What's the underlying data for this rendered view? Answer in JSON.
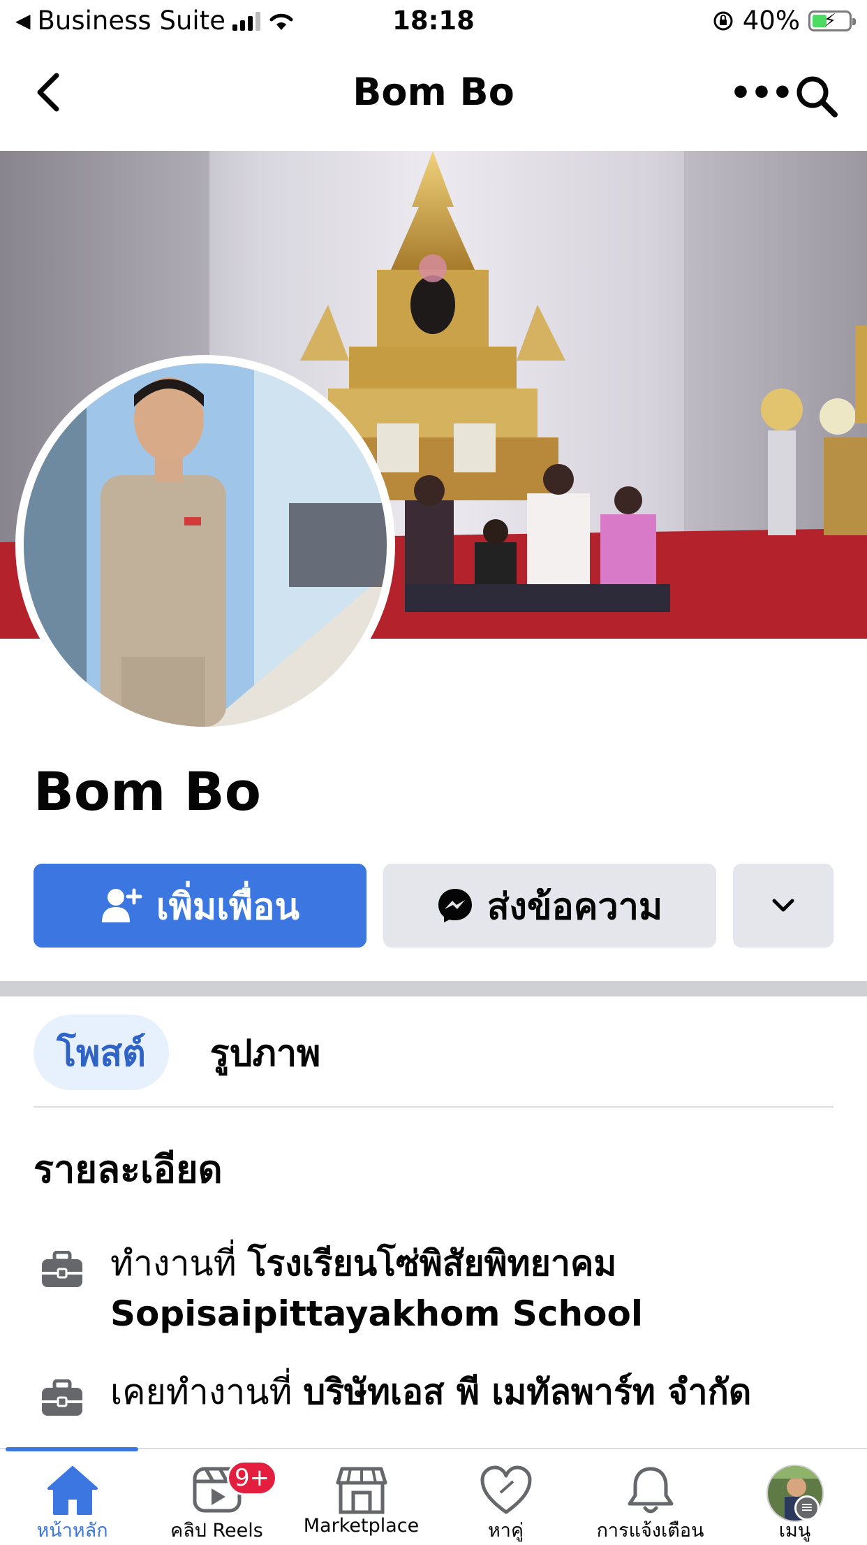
{
  "status_bar": {
    "carrier": "Business Suite",
    "time": "18:18",
    "battery": "40%",
    "battery_level": 0.4
  },
  "header": {
    "title": "Bom Bo",
    "icons": [
      "back-arrow-icon",
      "more-icon",
      "search-icon"
    ]
  },
  "profile": {
    "name": "Bom Bo"
  },
  "actions": {
    "add_friend": "เพิ่มเพื่อน",
    "message": "ส่งข้อความ"
  },
  "tabs": [
    {
      "label": "โพสต์",
      "active": true
    },
    {
      "label": "รูปภาพ",
      "active": false
    }
  ],
  "details": {
    "title": "รายละเอียด",
    "items": [
      {
        "prefix": "ทำงานที่",
        "value": "โรงเรียนโซ่พิสัยพิทยาคม Sopisaipittayakhom School",
        "icon": "briefcase-icon"
      },
      {
        "prefix": "เคยทำงานที่",
        "value": "บริษัทเอส พี เมทัลพาร์ท จำกัด",
        "icon": "briefcase-icon"
      }
    ]
  },
  "bottom_tabs": [
    {
      "label": "หน้าหลัก",
      "icon": "home-icon",
      "active": true
    },
    {
      "label": "คลิป Reels",
      "icon": "reels-icon",
      "badge": "9+"
    },
    {
      "label": "Marketplace",
      "icon": "marketplace-icon"
    },
    {
      "label": "หาคู่",
      "icon": "dating-heart-icon"
    },
    {
      "label": "การแจ้งเตือน",
      "icon": "bell-icon"
    },
    {
      "label": "เมนู",
      "icon": "menu-avatar-icon"
    }
  ],
  "colors": {
    "accent": "#3b76e1",
    "button_gray": "#e4e6eb",
    "badge_red": "#e41e3f",
    "tab_active_bg": "#e7f0fd"
  }
}
